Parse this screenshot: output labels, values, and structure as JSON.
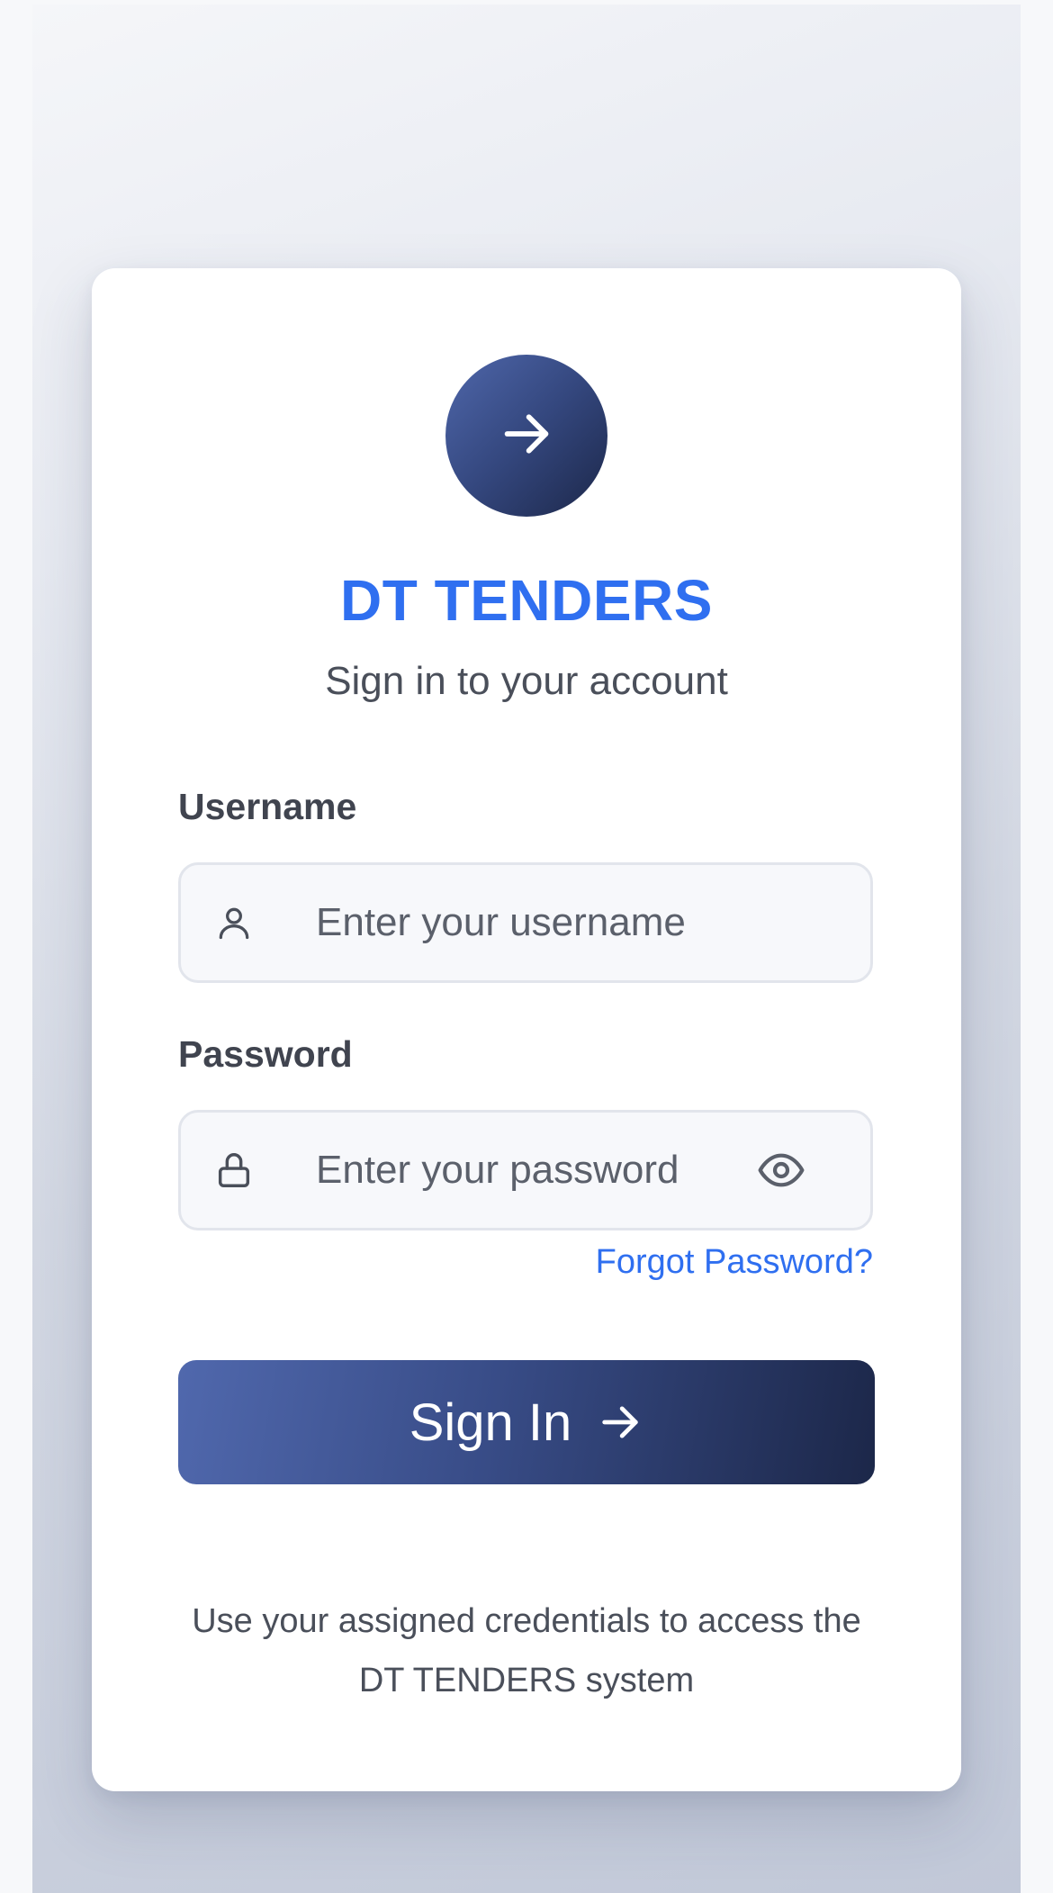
{
  "app": {
    "title": "DT TENDERS",
    "subtitle": "Sign in to your account"
  },
  "logo": {
    "icon": "arrow-right-icon"
  },
  "form": {
    "username": {
      "label": "Username",
      "placeholder": "Enter your username",
      "icon": "user-icon"
    },
    "password": {
      "label": "Password",
      "placeholder": "Enter your password",
      "icon": "lock-icon",
      "toggle_icon": "eye-icon"
    },
    "forgot_label": "Forgot Password?",
    "submit_label": "Sign In"
  },
  "footer_note": "Use your assigned credentials to access the DT TENDERS system",
  "colors": {
    "accent": "#2f6ff0",
    "button_start": "#5068ad",
    "button_end": "#1c2749"
  }
}
